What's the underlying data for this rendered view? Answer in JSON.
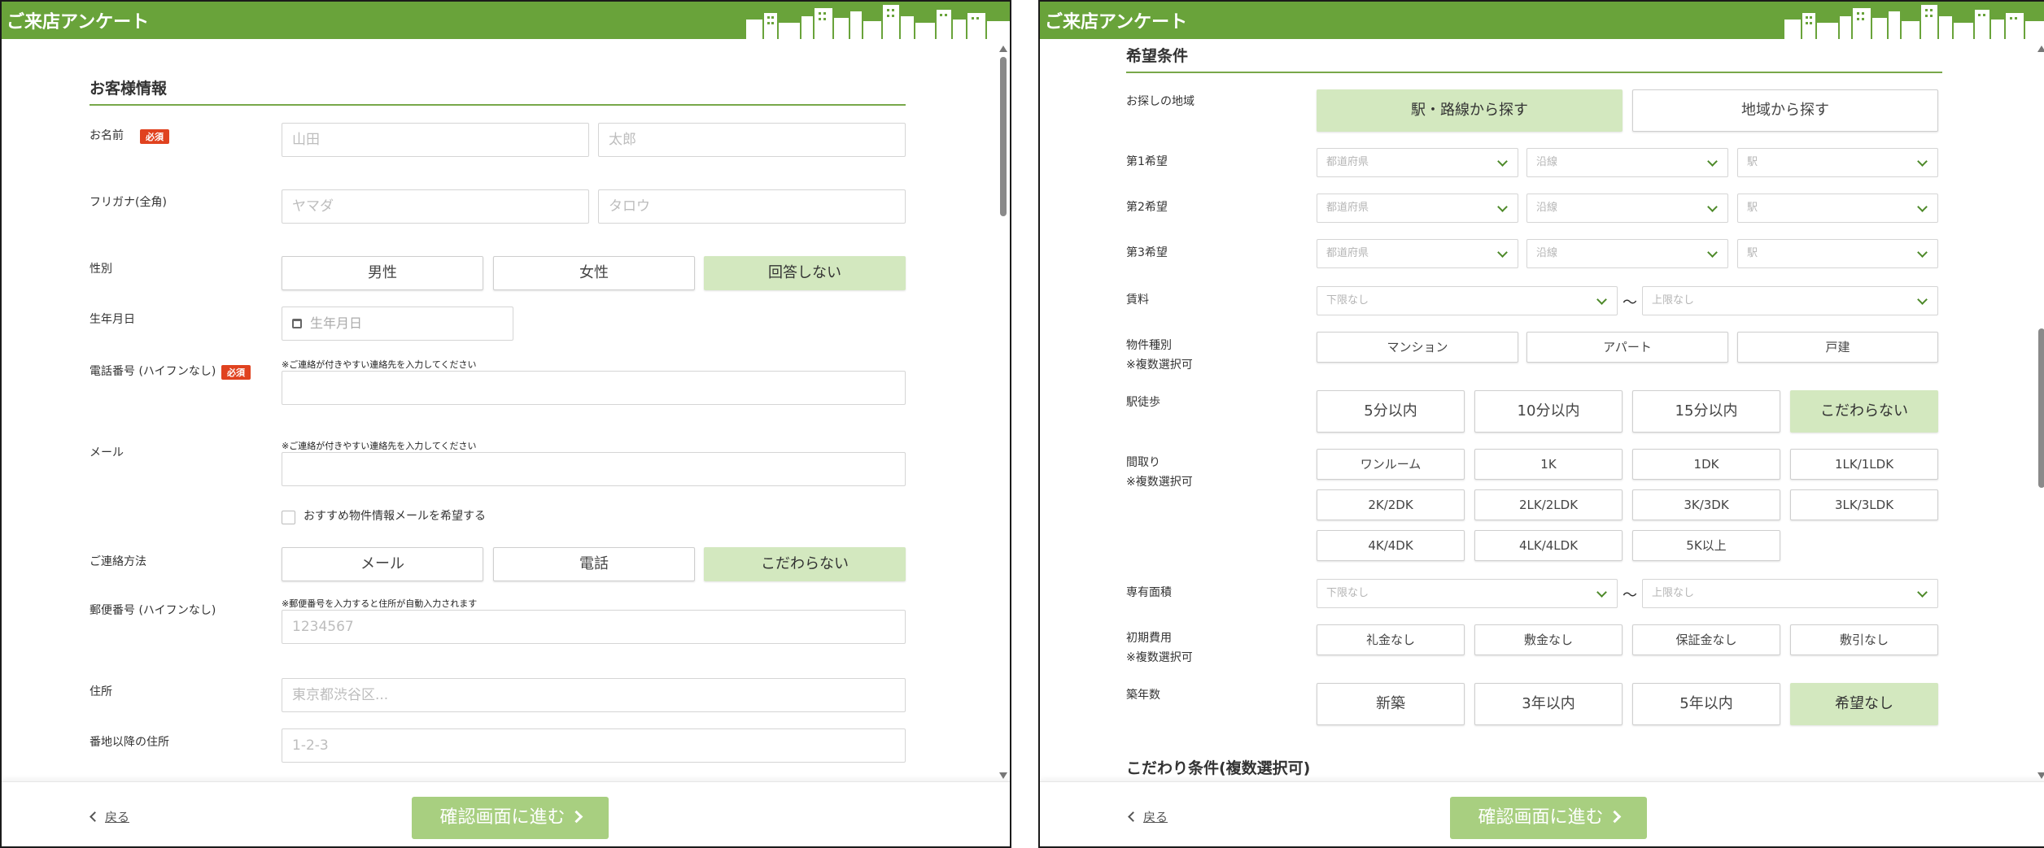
{
  "app_title": "ご来店アンケート",
  "footer": {
    "back_label": "戻る",
    "next_label": "確認画面に進む"
  },
  "left": {
    "section_title": "お客様情報",
    "required_badge": "必須",
    "name": {
      "label": "お名前",
      "last_placeholder": "山田",
      "first_placeholder": "太郎"
    },
    "kana": {
      "label": "フリガナ(全角)",
      "last_placeholder": "ヤマダ",
      "first_placeholder": "タロウ"
    },
    "gender": {
      "label": "性別",
      "options": [
        "男性",
        "女性",
        "回答しない"
      ],
      "selected_index": 2
    },
    "birthday": {
      "label": "生年月日",
      "placeholder": "生年月日"
    },
    "phone": {
      "label": "電話番号 (ハイフンなし)",
      "note": "※ご連絡が付きやすい連絡先を入力してください"
    },
    "email": {
      "label": "メール",
      "note": "※ご連絡が付きやすい連絡先を入力してください"
    },
    "newsletter": {
      "label": "おすすめ物件情報メールを希望する"
    },
    "contact": {
      "label": "ご連絡方法",
      "options": [
        "メール",
        "電話",
        "こだわらない"
      ],
      "selected_index": 2
    },
    "postal": {
      "label": "郵便番号 (ハイフンなし)",
      "note": "※郵便番号を入力すると住所が自動入力されます",
      "placeholder": "1234567"
    },
    "address": {
      "label": "住所",
      "placeholder": "東京都渋谷区..."
    },
    "address2": {
      "label": "番地以降の住所",
      "placeholder": "1-2-3"
    }
  },
  "right": {
    "section_title": "希望条件",
    "area": {
      "label": "お探しの地域",
      "options": [
        "駅・路線から探す",
        "地域から探す"
      ],
      "selected_index": 0
    },
    "wishes": [
      {
        "label": "第1希望",
        "pref": "都道府県",
        "line": "沿線",
        "station": "駅"
      },
      {
        "label": "第2希望",
        "pref": "都道府県",
        "line": "沿線",
        "station": "駅"
      },
      {
        "label": "第3希望",
        "pref": "都道府県",
        "line": "沿線",
        "station": "駅"
      }
    ],
    "rent": {
      "label": "賃料",
      "min": "下限なし",
      "tilde": "〜",
      "max": "上限なし"
    },
    "property_type": {
      "label": "物件種別\n※複数選択可",
      "options": [
        "マンション",
        "アパート",
        "戸建"
      ]
    },
    "walk": {
      "label": "駅徒歩",
      "options": [
        "5分以内",
        "10分以内",
        "15分以内",
        "こだわらない"
      ],
      "selected_index": 3
    },
    "layout": {
      "label": "間取り\n※複数選択可",
      "options": [
        "ワンルーム",
        "1K",
        "1DK",
        "1LK/1LDK",
        "2K/2DK",
        "2LK/2LDK",
        "3K/3DK",
        "3LK/3LDK",
        "4K/4DK",
        "4LK/4LDK",
        "5K以上"
      ]
    },
    "area_size": {
      "label": "専有面積",
      "min": "下限なし",
      "tilde": "〜",
      "max": "上限なし"
    },
    "initial_cost": {
      "label": "初期費用\n※複数選択可",
      "options": [
        "礼金なし",
        "敷金なし",
        "保証金なし",
        "敷引なし"
      ]
    },
    "age": {
      "label": "築年数",
      "options": [
        "新築",
        "3年以内",
        "5年以内",
        "希望なし"
      ],
      "selected_index": 3
    },
    "kodawari_title": "こだわり条件(複数選択可)"
  },
  "colors": {
    "header": "#69a33a",
    "selected": "#d3e8bf",
    "primary_button": "#a8cf80",
    "required_badge": "#e0421f",
    "section_line": "#78a84a"
  },
  "icons": [
    "skyline-icon",
    "calendar-icon",
    "chevron-down-icon",
    "chevron-left-icon",
    "chevron-right-icon"
  ]
}
